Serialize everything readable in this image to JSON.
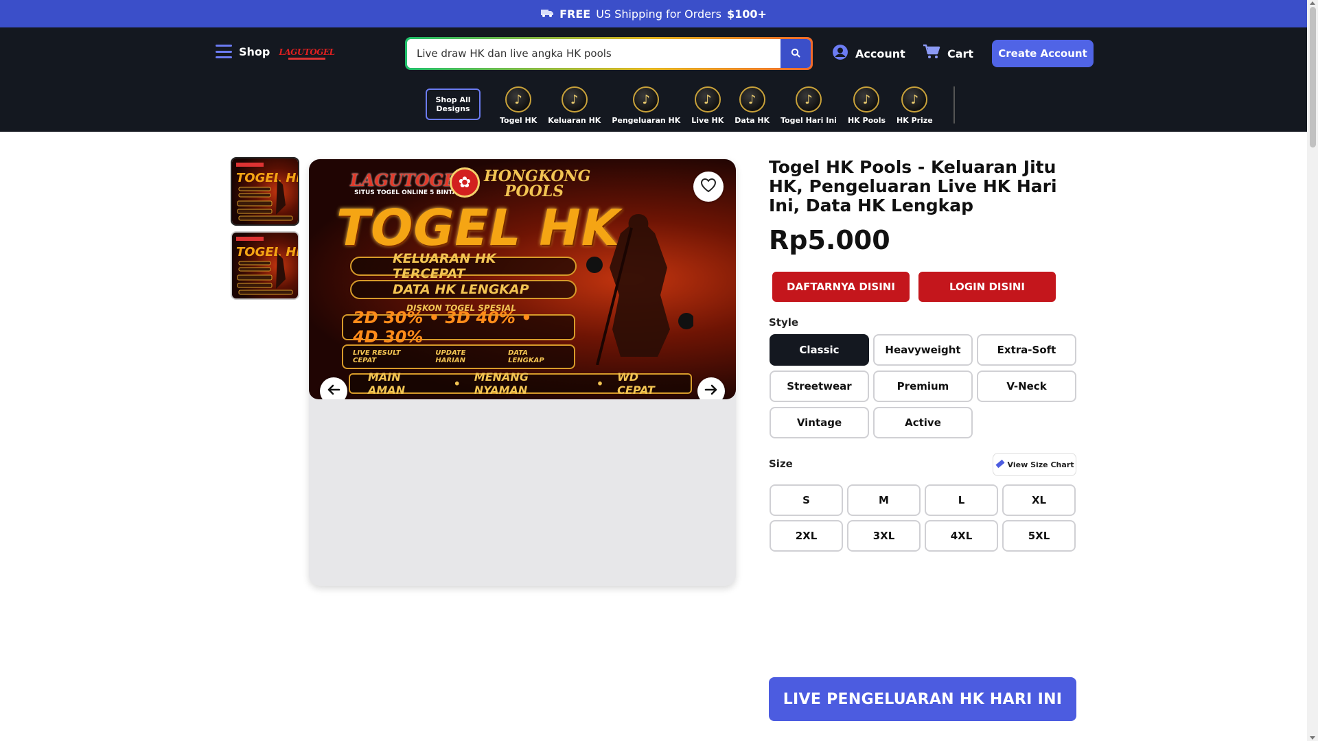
{
  "promo": {
    "bold": "FREE",
    "text": "US Shipping for Orders",
    "amount": "$100+"
  },
  "header": {
    "shop_label": "Shop",
    "logo_text": "LAGUTOGEL",
    "search": {
      "value": "Live draw HK dan live angka HK pools",
      "placeholder": ""
    },
    "account_label": "Account",
    "cart_label": "Cart",
    "create_account_label": "Create Account"
  },
  "categories": {
    "shop_all": "Shop All Designs",
    "items": [
      "Togel HK",
      "Keluaran HK",
      "Pengeluaran HK",
      "Live HK",
      "Data HK",
      "Togel Hari Ini",
      "HK Pools",
      "HK Prize"
    ]
  },
  "banner": {
    "brand": "LAGUTOGEL",
    "sub": "SITUS TOGEL ONLINE 5 BINTANG",
    "hk_title_1": "HONGKONG",
    "hk_title_2": "POOLS",
    "big": "TOGEL HK",
    "row1": "KELUARAN HK TERCEPAT",
    "row2": "DATA HK LENGKAP",
    "row3": "DISKON TOGEL SPESIAL",
    "row4": "2D 30% • 3D 40% • 4D 30%",
    "row5": [
      "LIVE RESULT CEPAT",
      "UPDATE HARIAN",
      "DATA LENGKAP"
    ],
    "row6": [
      "MAIN AMAN",
      "MENANG NYAMAN",
      "WD CEPAT"
    ]
  },
  "product": {
    "title": "Togel HK Pools - Keluaran Jitu HK, Pengeluaran Live HK Hari Ini, Data HK Lengkap",
    "price": "Rp5.000",
    "register_label": "DAFTARNYA DISINI",
    "login_label": "LOGIN DISINI",
    "style_label": "Style",
    "styles": [
      "Classic",
      "Heavyweight",
      "Extra-Soft",
      "Streetwear",
      "Premium",
      "V-Neck",
      "Vintage",
      "Active"
    ],
    "selected_style": "Classic",
    "size_label": "Size",
    "size_chart_label": "View Size Chart",
    "sizes": [
      "S",
      "M",
      "L",
      "XL",
      "2XL",
      "3XL",
      "4XL",
      "5XL"
    ]
  },
  "live_button": "LIVE PENGELUARAN HK HARI INI",
  "colors": {
    "brand_blue": "#3b4fc9",
    "header_bg": "#141820",
    "cta_red": "#c4161c"
  }
}
